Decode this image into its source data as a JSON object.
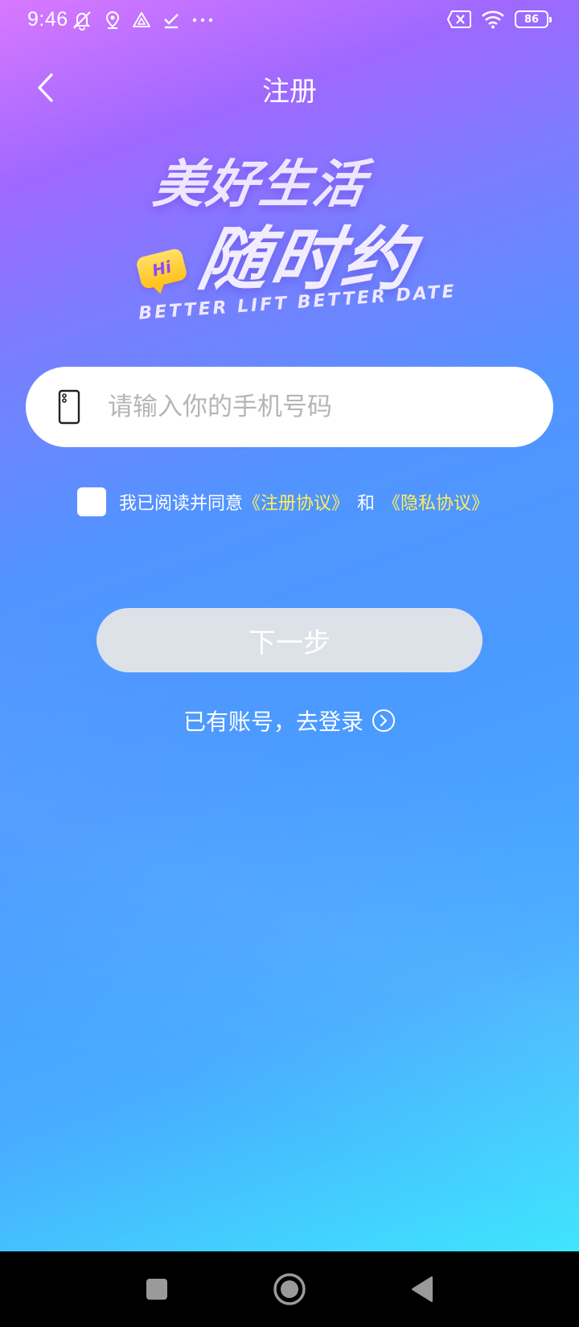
{
  "status_bar": {
    "time": "9:46",
    "battery": "86",
    "icons_left": [
      "mute-vibrate-icon",
      "location-icon",
      "drive-icon",
      "download-done-icon",
      "more-dots-icon"
    ],
    "icons_right": [
      "sim-x-icon",
      "wifi-icon",
      "battery-icon"
    ]
  },
  "header": {
    "title": "注册",
    "back_icon": "chevron-left-icon"
  },
  "hero": {
    "line1": "美好生活",
    "line2": "随时约",
    "badge": "Hi",
    "tagline": "BETTER LIFT BETTER DATE"
  },
  "phone_field": {
    "placeholder": "请输入你的手机号码",
    "value": "",
    "icon": "phone-icon"
  },
  "agreement": {
    "checked": false,
    "prefix": "我已阅读并同意",
    "link1": "《注册协议》",
    "and": "和",
    "link2": "《隐私协议》"
  },
  "next_button": {
    "label": "下一步",
    "color": "#dce2e8"
  },
  "login_link": {
    "label": "已有账号，去登录",
    "icon": "chevron-right-circle-icon"
  },
  "nav_bar": {
    "icons": [
      "recents-square-icon",
      "home-circle-icon",
      "back-triangle-icon"
    ]
  },
  "colors": {
    "link": "#ffef5c",
    "gradient_top": "#d878ff",
    "gradient_bottom": "#3fe5fd"
  }
}
